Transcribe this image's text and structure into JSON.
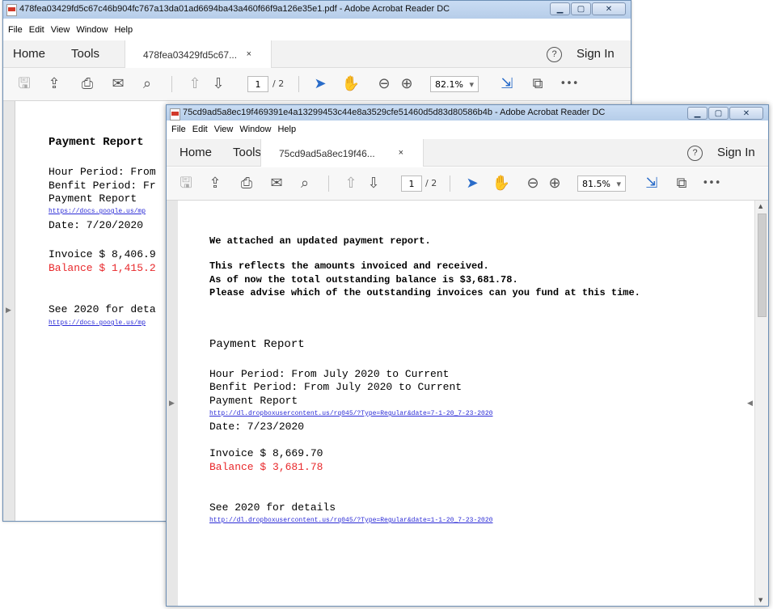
{
  "back_window": {
    "title": "478fea03429fd5c67c46b904fc767a13da01ad6694ba43a460f66f9a126e35e1.pdf - Adobe Acrobat Reader DC",
    "menu": [
      "File",
      "Edit",
      "View",
      "Window",
      "Help"
    ],
    "nav_home": "Home",
    "nav_tools": "Tools",
    "doc_tab": "478fea03429fd5c67...",
    "tab_close": "×",
    "help": "?",
    "sign_in": "Sign In",
    "page_current": "1",
    "page_total": "/ 2",
    "zoom": "82.1%",
    "more": "•••",
    "report_title": "Payment Report",
    "line_hour": "Hour Period: From",
    "line_benefit": "Benfit Period: Fr",
    "line_report": "Payment Report",
    "link1": "https://docs.google.us/mp",
    "date": "Date: 7/20/2020",
    "invoice": "Invoice $ 8,406.9",
    "balance": "Balance $ 1,415.2",
    "see": "See 2020 for deta",
    "link2": "https://docs.google.us/mp"
  },
  "front_window": {
    "title": "75cd9ad5a8ec19f469391e4a13299453c44e8a3529cfe51460d5d83d80586b4b - Adobe Acrobat Reader DC",
    "menu": [
      "File",
      "Edit",
      "View",
      "Window",
      "Help"
    ],
    "nav_home": "Home",
    "nav_tools": "Tools",
    "doc_tab": "75cd9ad5a8ec19f46...",
    "tab_close": "×",
    "help": "?",
    "sign_in": "Sign In",
    "page_current": "1",
    "page_total": "/ 2",
    "zoom": "81.5%",
    "more": "•••",
    "msg_line1": "We attached an updated payment report.",
    "msg_line2": "This reflects the amounts invoiced and received.",
    "msg_line3": "As of now the total outstanding balance is $3,681.78.",
    "msg_line4": "Please advise which of the outstanding invoices can you fund at this time.",
    "report_title": "Payment Report",
    "line_hour": "Hour Period: From July 2020 to Current",
    "line_benefit": "Benfit Period: From July 2020 to Current",
    "line_report": "Payment Report",
    "link1": "http://dl.dropboxusercontent.us/rq045/?Type=Regular&date=7-1-20_7-23-2020",
    "date": "Date: 7/23/2020",
    "invoice": "Invoice $ 8,669.70",
    "balance": "Balance $ 3,681.78",
    "see": "See 2020 for details",
    "link2": "http://dl.dropboxusercontent.us/rq045/?Type=Regular&date=1-1-20_7-23-2020"
  },
  "colors": {
    "balance_red": "#e8282b",
    "link_blue": "#2b2bd6",
    "toolbar_blue": "#2a6cc9"
  }
}
